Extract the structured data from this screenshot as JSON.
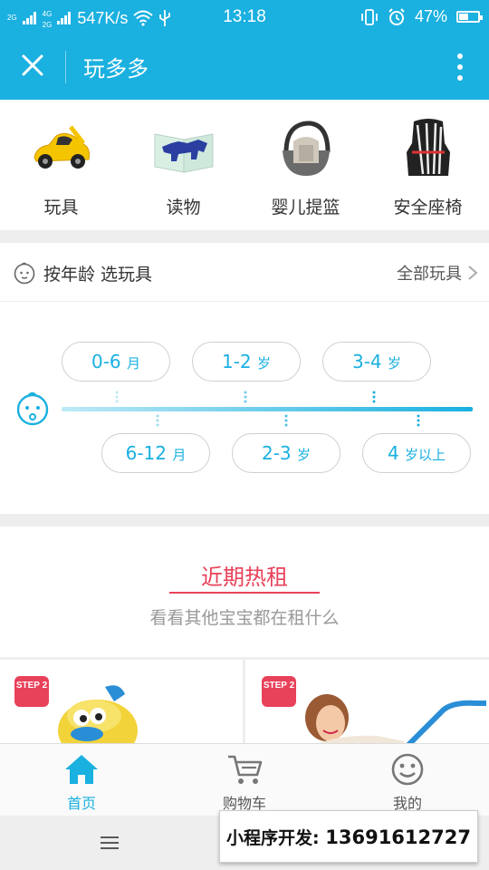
{
  "status_bar": {
    "network_a": "2G",
    "network_b": "4G",
    "network_c": "2G",
    "speed": "547K/s",
    "time": "13:18",
    "battery_text": "47%",
    "battery_level": 0.47,
    "icons": [
      "signal-icon",
      "wifi-icon",
      "usb-icon",
      "vibrate-icon",
      "alarm-icon",
      "battery-icon"
    ]
  },
  "title_bar": {
    "title": "玩多多",
    "color": "#1ab0e0",
    "icons": [
      "close-icon",
      "more-vertical-icon"
    ]
  },
  "categories": [
    {
      "label": "玩具",
      "icon": "toy-car-icon"
    },
    {
      "label": "读物",
      "icon": "book-icon"
    },
    {
      "label": "婴儿提篮",
      "icon": "baby-carrier-icon"
    },
    {
      "label": "安全座椅",
      "icon": "car-seat-icon"
    }
  ],
  "age_section": {
    "title": "按年龄 选玩具",
    "all_link": "全部玩具",
    "top_pills": [
      {
        "num": "0-6",
        "unit": "月"
      },
      {
        "num": "1-2",
        "unit": "岁"
      },
      {
        "num": "3-4",
        "unit": "岁"
      }
    ],
    "bottom_pills": [
      {
        "num": "6-12",
        "unit": "月"
      },
      {
        "num": "2-3",
        "unit": "岁"
      },
      {
        "num": "4",
        "unit": "岁以上"
      }
    ]
  },
  "hot_section": {
    "title": "近期热租",
    "subtitle": "看看其他宝宝都在租什么",
    "accent": "#e8415a"
  },
  "products": [
    {
      "badge": "STEP 2"
    },
    {
      "badge": "STEP 2"
    }
  ],
  "tab_bar": {
    "tabs": [
      {
        "label": "首页",
        "icon": "home-icon",
        "active": true
      },
      {
        "label": "购物车",
        "icon": "cart-icon",
        "active": false
      },
      {
        "label": "我的",
        "icon": "smiley-icon",
        "active": false
      }
    ]
  },
  "promo": {
    "label": "小程序开发:",
    "phone": "13691612727"
  }
}
